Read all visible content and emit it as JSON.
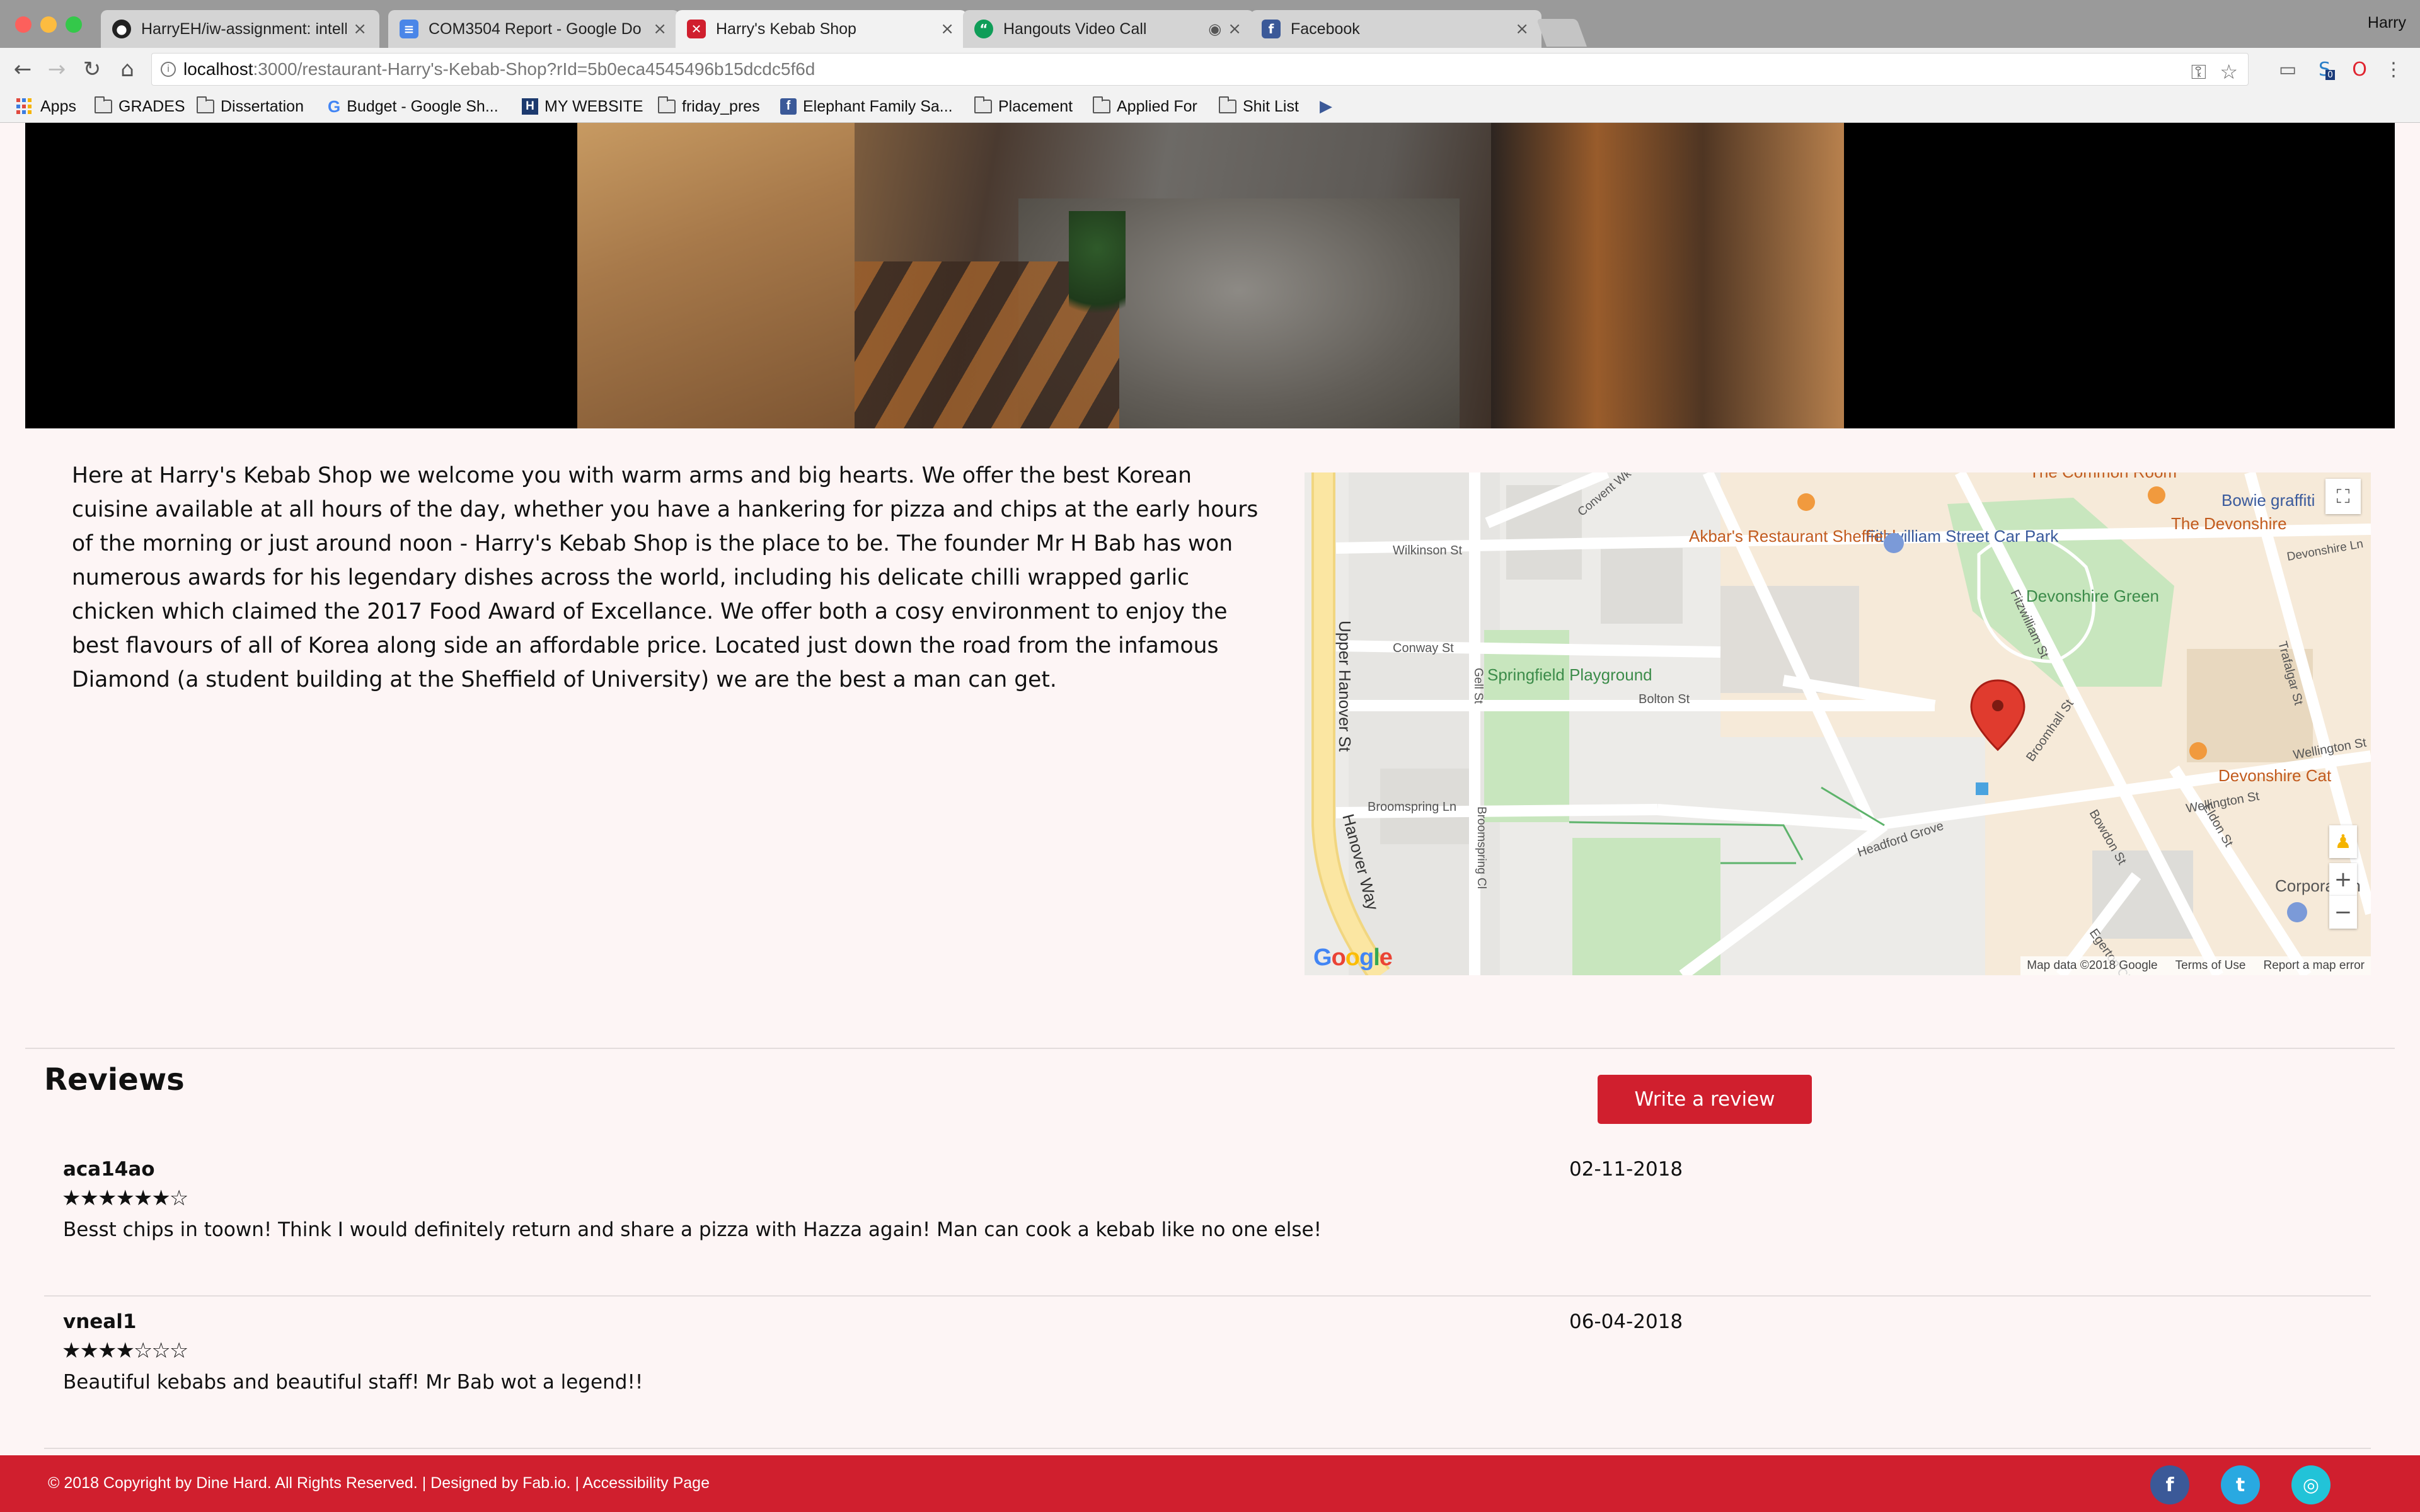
{
  "browser": {
    "tabs": [
      {
        "title": "HarryEH/iw-assignment: intelli",
        "icon": "github-icon"
      },
      {
        "title": "COM3504 Report - Google Do",
        "icon": "google-docs-icon"
      },
      {
        "title": "Harry's Kebab Shop",
        "icon": "restaurant-icon",
        "active": true
      },
      {
        "title": "Hangouts Video Call",
        "icon": "hangouts-icon"
      },
      {
        "title": "Facebook",
        "icon": "facebook-icon"
      }
    ],
    "profile_name": "Harry",
    "url_host": "localhost",
    "url_path": ":3000/restaurant-Harry's-Kebab-Shop?rId=5b0eca4545496b15dcdc5f6d",
    "bookmarks": [
      {
        "label": "Apps",
        "icon": "apps-icon"
      },
      {
        "label": "GRADES",
        "icon": "folder-icon"
      },
      {
        "label": "Dissertation",
        "icon": "folder-icon"
      },
      {
        "label": "Budget - Google Sh...",
        "icon": "google-icon"
      },
      {
        "label": "MY WEBSITE",
        "icon": "website-icon"
      },
      {
        "label": "friday_pres",
        "icon": "folder-icon"
      },
      {
        "label": "Elephant Family Sa...",
        "icon": "facebook-icon"
      },
      {
        "label": "Placement",
        "icon": "folder-icon"
      },
      {
        "label": "Applied For",
        "icon": "folder-icon"
      },
      {
        "label": "Shit List",
        "icon": "folder-icon"
      }
    ],
    "extension_badge": "0"
  },
  "restaurant": {
    "description": "Here at Harry's Kebab Shop we welcome you with warm arms and big hearts. We offer the best Korean cuisine available at all hours of the day, whether you have a hankering for pizza and chips at the early hours of the morning or just around noon - Harry's Kebab Shop is the place to be. The founder Mr H Bab has won numerous awards for his legendary dishes across the world, including his delicate chilli wrapped garlic chicken which claimed the 2017 Food Award of Excellance. We offer both a cosy environment to enjoy the best flavours of all of Korea along side an affordable price. Located just down the road from the infamous Diamond (a student building at the Sheffield of University) we are the best a man can get."
  },
  "map": {
    "labels": {
      "fitzwilliam_car_park": "Fitzwilliam Street Car Park",
      "akbars": "Akbar's Restaurant Sheffield",
      "bowie": "Bowie graffiti",
      "the_devonshire": "The Devonshire",
      "common_room": "The Common Room",
      "devonshire_green": "Devonshire Green",
      "springfield": "Springfield Playground",
      "devonshire_cat": "Devonshire Cat",
      "corporation": "Corporation",
      "upper_hanover": "Upper Hanover St",
      "hanover_way": "Hanover Way",
      "wilkinson": "Wilkinson St",
      "conway": "Conway St",
      "bolton": "Bolton St",
      "broomhall": "Broomhall St",
      "broomspring_ln": "Broomspring Ln",
      "broomspring_cl": "Broomspring Cl",
      "headford": "Headford Grove",
      "wellington": "Wellington St",
      "fitzwilliam_st": "Fitzwilliam St",
      "trafalgar": "Trafalgar St",
      "eldon": "Eldon St",
      "bowdon": "Bowdon St",
      "egerton": "Egerton Cl",
      "gell": "Gell St",
      "convent": "Convent Wk",
      "devonshire_ln": "Devonshire Ln"
    },
    "attribution": [
      "Map data ©2018 Google",
      "Terms of Use",
      "Report a map error"
    ],
    "logo": "Google",
    "zoom_in": "+",
    "zoom_out": "−"
  },
  "reviews": {
    "heading": "Reviews",
    "write_button": "Write a review",
    "items": [
      {
        "user": "aca14ao",
        "date": "02-11-2018",
        "rating": 6,
        "max_rating": 7,
        "stars": "★★★★★★☆",
        "text": "Besst chips in toown! Think I would definitely return and share a pizza with Hazza again! Man can cook a kebab like no one else!"
      },
      {
        "user": "vneal1",
        "date": "06-04-2018",
        "rating": 4,
        "max_rating": 7,
        "stars": "★★★★☆☆☆",
        "text": "Beautiful kebabs and beautiful staff! Mr Bab wot a legend!!"
      }
    ]
  },
  "footer": {
    "text": "© 2018 Copyright by Dine Hard. All Rights Reserved. | Designed by Fab.io. | Accessibility Page",
    "social": [
      {
        "icon": "facebook-icon",
        "color": "#3b5998",
        "glyph": "f"
      },
      {
        "icon": "twitter-icon",
        "color": "#29a9e1",
        "glyph": "t"
      },
      {
        "icon": "instagram-icon",
        "color": "#22c3d8",
        "glyph": "◎"
      }
    ]
  },
  "colors": {
    "accent": "#d01f2e",
    "page_bg": "#fdf5f5"
  }
}
